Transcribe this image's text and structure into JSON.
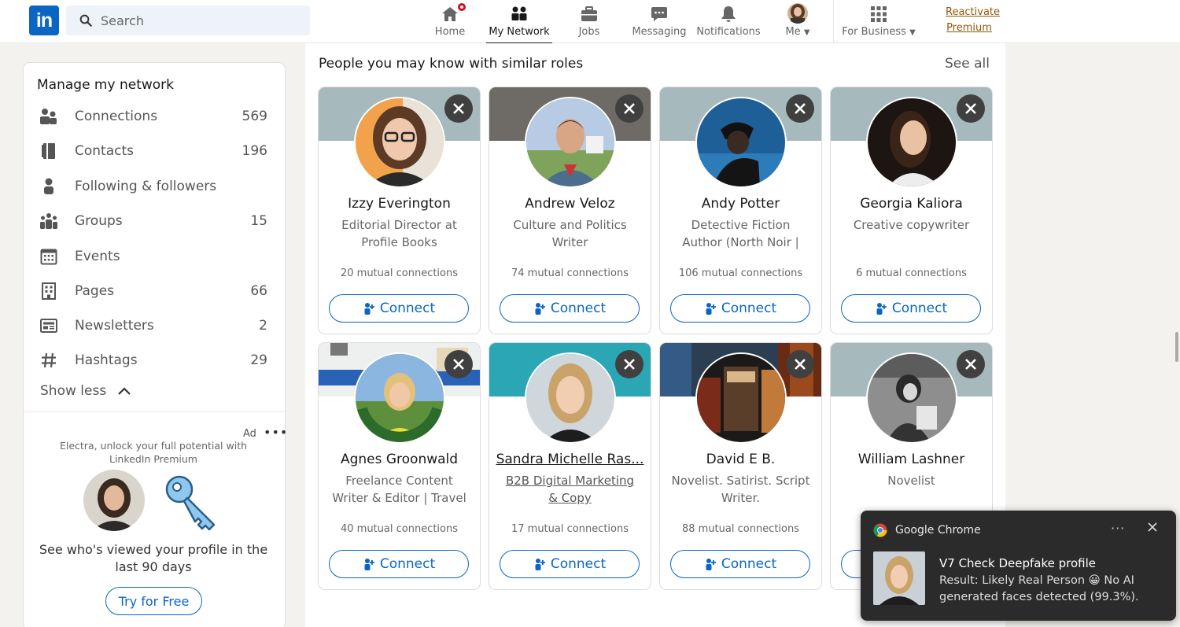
{
  "nav": {
    "search_placeholder": "Search",
    "items": [
      {
        "label": "Home",
        "icon": "home-icon"
      },
      {
        "label": "My Network",
        "icon": "network-icon"
      },
      {
        "label": "Jobs",
        "icon": "briefcase-icon"
      },
      {
        "label": "Messaging",
        "icon": "messaging-icon"
      },
      {
        "label": "Notifications",
        "icon": "bell-icon"
      },
      {
        "label": "Me",
        "icon": "avatar"
      },
      {
        "label": "For Business",
        "icon": "grid-icon"
      }
    ],
    "premium_line1": "Reactivate",
    "premium_line2": "Premium",
    "logo_text": "in"
  },
  "sidebar": {
    "title": "Manage my network",
    "items": [
      {
        "label": "Connections",
        "count": "569"
      },
      {
        "label": "Contacts",
        "count": "196"
      },
      {
        "label": "Following & followers",
        "count": ""
      },
      {
        "label": "Groups",
        "count": "15"
      },
      {
        "label": "Events",
        "count": ""
      },
      {
        "label": "Pages",
        "count": "66"
      },
      {
        "label": "Newsletters",
        "count": "2"
      },
      {
        "label": "Hashtags",
        "count": "29"
      }
    ],
    "show_less": "Show less"
  },
  "ad": {
    "label": "Ad",
    "more": "•••",
    "text": "Electra, unlock your full potential with LinkedIn Premium",
    "description": "See who's viewed your profile in the last 90 days",
    "cta": "Try for Free"
  },
  "main": {
    "title": "People you may know with similar roles",
    "see_all": "See all",
    "connect_label": "Connect",
    "cards": [
      {
        "name": "Izzy Everington",
        "headline": "Editorial Director at Profile Books",
        "mutual": "20 mutual connections"
      },
      {
        "name": "Andrew Veloz",
        "headline": "Culture and Politics Writer",
        "mutual": "74 mutual connections"
      },
      {
        "name": "Andy Potter",
        "headline": "Detective Fiction Author (North Noir | Black Opal..",
        "mutual": "106 mutual connections"
      },
      {
        "name": "Georgia Kaliora",
        "headline": "Creative copywriter",
        "mutual": "6 mutual connections"
      },
      {
        "name": "Agnes Groonwald",
        "headline": "Freelance Content Writer & Editor | Travel Blogger",
        "mutual": "40 mutual connections"
      },
      {
        "name": "Sandra Michelle Ras...",
        "headline": "B2B Digital Marketing & Copy",
        "mutual": "17 mutual connections"
      },
      {
        "name": "David E B.",
        "headline": "Novelist. Satirist. Script Writer.",
        "mutual": "88 mutual connections"
      },
      {
        "name": "William Lashner",
        "headline": "Novelist",
        "mutual": ""
      }
    ]
  },
  "toast": {
    "app": "Google Chrome",
    "more": "···",
    "title": "V7 Check Deepfake profile",
    "body_part1": "Result: Likely Real Person",
    "body_emoji": "😀",
    "body_part2": "No AI generated faces detected (99.3%)."
  },
  "colors": {
    "brand": "#0a66c2",
    "notification_badge": "#cc1016",
    "premium": "#915907"
  }
}
